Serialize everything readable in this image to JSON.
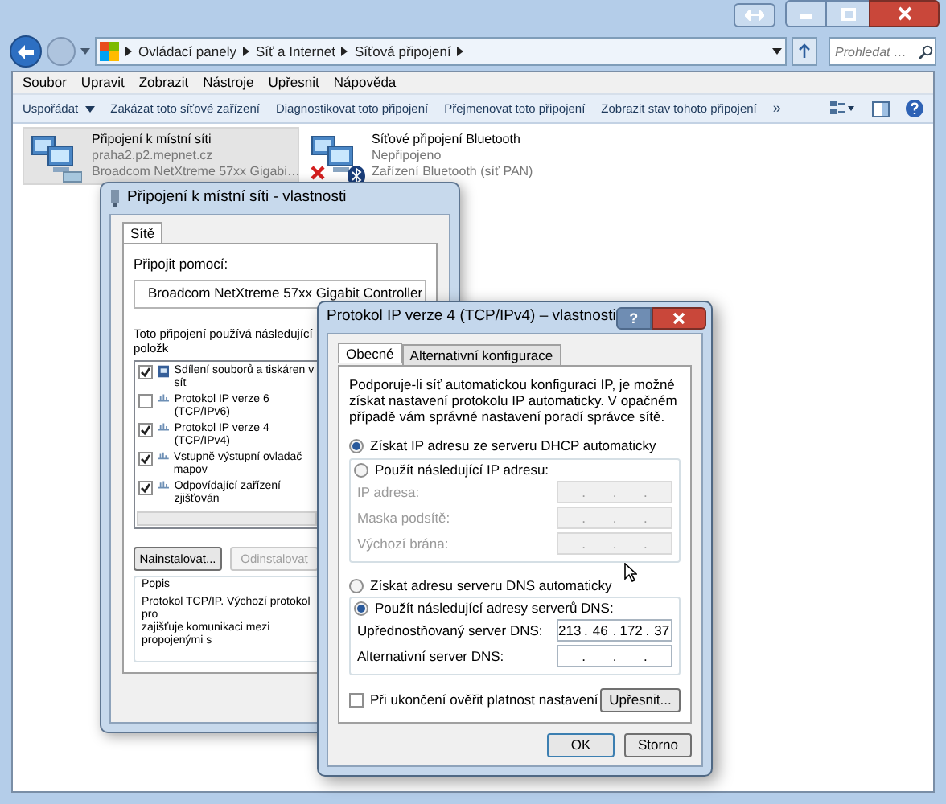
{
  "address_bar": {
    "crumbs": [
      "Ovládací panely",
      "Síť a Internet",
      "Síťová připojení"
    ]
  },
  "search": {
    "placeholder": "Prohledat …"
  },
  "menu": [
    "Soubor",
    "Upravit",
    "Zobrazit",
    "Nástroje",
    "Upřesnit",
    "Nápověda"
  ],
  "toolbar": {
    "organize": "Uspořádat",
    "commands": [
      "Zakázat toto síťové zařízení",
      "Diagnostikovat toto připojení",
      "Přejmenovat toto připojení",
      "Zobrazit stav tohoto připojení"
    ],
    "more": "»"
  },
  "connections": [
    {
      "name": "Připojení k místní síti",
      "detail": "praha2.p2.mepnet.cz",
      "device": "Broadcom NetXtreme 57xx Gigabi…",
      "selected": true,
      "kind": "ethernet",
      "disconnected": false
    },
    {
      "name": "Síťové připojení Bluetooth",
      "detail": "Nepřipojeno",
      "device": "Zařízení Bluetooth (síť PAN)",
      "selected": false,
      "kind": "bluetooth",
      "disconnected": true
    }
  ],
  "dialog_lan": {
    "title": "Připojení k místní síti - vlastnosti",
    "tabs": [
      {
        "label": "Sítě",
        "selected": true
      }
    ],
    "connect_using_label": "Připojit pomocí:",
    "adapter": "Broadcom NetXtreme 57xx Gigabit Controller",
    "items_label": "Toto připojení používá následující položk",
    "items": [
      {
        "label": "Sdílení souborů a tiskáren v sít",
        "checked": true,
        "kind": "service"
      },
      {
        "label": "Protokol IP verze 6 (TCP/IPv6)",
        "checked": false,
        "kind": "protocol"
      },
      {
        "label": "Protokol IP verze 4 (TCP/IPv4)",
        "checked": true,
        "kind": "protocol"
      },
      {
        "label": "Vstupně výstupní ovladač mapov",
        "checked": true,
        "kind": "protocol"
      },
      {
        "label": "Odpovídající zařízení zjišťován",
        "checked": true,
        "kind": "protocol"
      }
    ],
    "buttons": [
      {
        "label": "Nainstalovat...",
        "disabled": false
      },
      {
        "label": "Odinstalovat",
        "disabled": true
      }
    ],
    "description": {
      "title": "Popis",
      "lines": [
        "Protokol TCP/IP. Výchozí protokol pro",
        "zajišťuje komunikaci mezi propojenými s"
      ]
    }
  },
  "dialog_ipv4": {
    "title": "Protokol IP verze 4 (TCP/IPv4) – vlastnosti",
    "help": "?",
    "tabs": [
      {
        "label": "Obecné",
        "selected": true
      },
      {
        "label": "Alternativní konfigurace",
        "selected": false
      }
    ],
    "intro": "Podporuje-li síť automatickou konfiguraci IP, je možné získat nastavení protokolu IP automaticky. V opačném případě vám správné nastavení poradí správce sítě.",
    "ip_modes": [
      {
        "label": "Získat IP adresu ze serveru DHCP automaticky",
        "selected": true
      },
      {
        "label": "Použít následující IP adresu:",
        "selected": false
      }
    ],
    "ip_fields": [
      {
        "label": "IP adresa:",
        "disabled": true,
        "separators": [
          ".",
          ".",
          "."
        ]
      },
      {
        "label": "Maska podsítě:",
        "disabled": true,
        "separators": [
          ".",
          ".",
          "."
        ]
      },
      {
        "label": "Výchozí brána:",
        "disabled": true,
        "separators": [
          ".",
          ".",
          "."
        ]
      }
    ],
    "dns_modes": [
      {
        "label": "Získat adresu serveru DNS automaticky",
        "selected": false
      },
      {
        "label": "Použít následující adresy serverů DNS:",
        "selected": true
      }
    ],
    "dns_fields": [
      {
        "label": "Upřednostňovaný server DNS:",
        "disabled": false,
        "octets": [
          "213",
          "46",
          "172",
          "37"
        ],
        "separators": [
          ".",
          ".",
          "."
        ]
      },
      {
        "label": "Alternativní server DNS:",
        "disabled": false,
        "separators": [
          ".",
          ".",
          "."
        ]
      }
    ],
    "validate": {
      "label": "Při ukončení ověřit platnost nastavení",
      "checked": false
    },
    "advanced": "Upřesnit...",
    "buttons": [
      "OK",
      "Storno"
    ]
  }
}
